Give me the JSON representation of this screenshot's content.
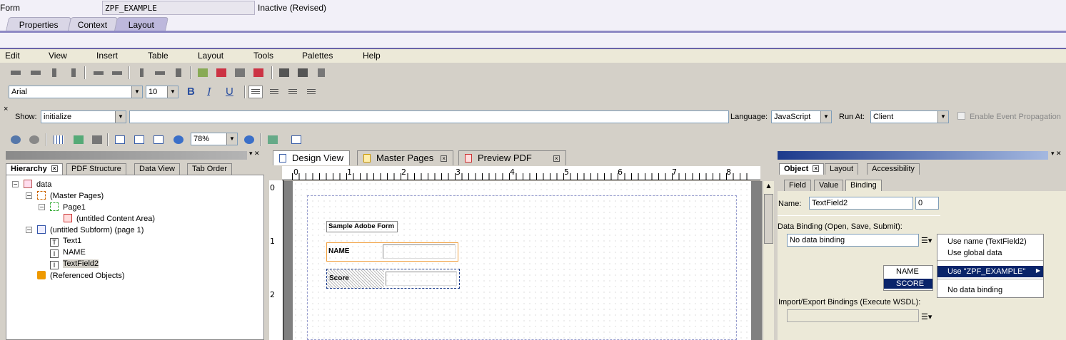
{
  "form_header": {
    "label": "Form",
    "name": "ZPF_EXAMPLE",
    "status": "Inactive (Revised)"
  },
  "top_tabs": [
    "Properties",
    "Context",
    "Layout"
  ],
  "menu": [
    "Edit",
    "View",
    "Insert",
    "Table",
    "Layout",
    "Tools",
    "Palettes",
    "Help"
  ],
  "font_toolbar": {
    "font": "Arial",
    "size": "10",
    "bold": "B",
    "italic": "I",
    "underline": "U"
  },
  "script_bar": {
    "close": "×",
    "show_label": "Show:",
    "show_value": "initialize",
    "language_label": "Language:",
    "language_value": "JavaScript",
    "runat_label": "Run At:",
    "runat_value": "Client",
    "enable_event": "Enable Event Propagation"
  },
  "zoom": "78%",
  "hierarchy": {
    "tabs": [
      "Hierarchy",
      "PDF Structure",
      "Data View",
      "Tab Order"
    ],
    "tree": [
      "data",
      "(Master Pages)",
      "Page1",
      "(untitled Content Area)",
      "(untitled Subform) (page 1)",
      "Text1",
      "NAME",
      "TextField2",
      "(Referenced Objects)"
    ]
  },
  "doc_tabs": [
    "Design View",
    "Master Pages",
    "Preview PDF"
  ],
  "ruler": {
    "h": [
      "0",
      "1",
      "2",
      "3",
      "4",
      "5",
      "6",
      "7",
      "8"
    ],
    "v": [
      "0",
      "1",
      "2"
    ]
  },
  "form_fields": {
    "title": "Sample Adobe Form",
    "name_label": "NAME",
    "score_label": "Score"
  },
  "object_panel": {
    "tabs": [
      "Object",
      "Layout",
      "Accessibility"
    ],
    "subtabs": [
      "Field",
      "Value",
      "Binding"
    ],
    "name_label": "Name:",
    "name_value": "TextField2",
    "name_index": "0",
    "binding_label": "Data Binding (Open, Save, Submit):",
    "binding_value": "No data binding",
    "import_label": "Import/Export Bindings (Execute WSDL):"
  },
  "context_menu": {
    "items": [
      "Use name (TextField2)",
      "Use global data",
      "Use \"ZPF_EXAMPLE\"",
      "No data binding"
    ]
  },
  "submenu": {
    "items": [
      "NAME",
      "SCORE"
    ]
  }
}
